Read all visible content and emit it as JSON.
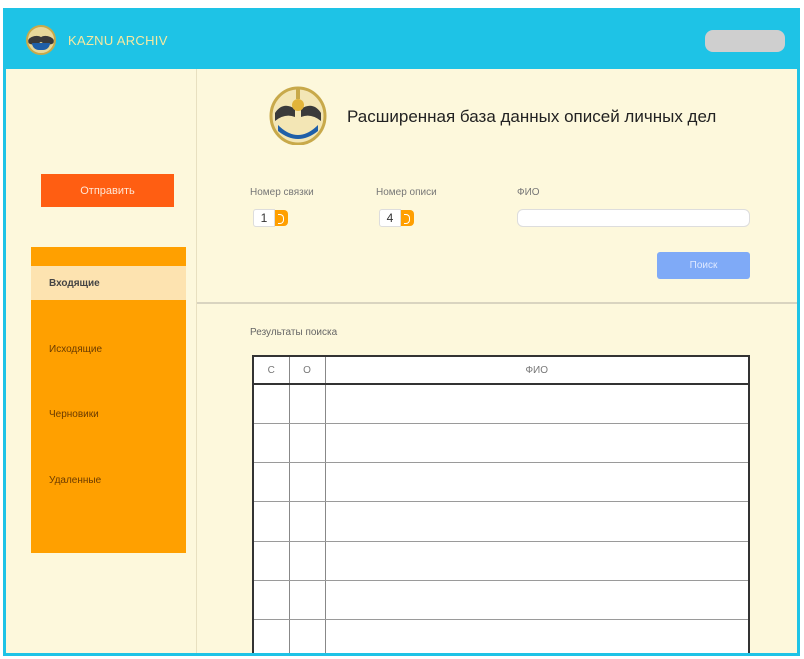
{
  "header": {
    "app_title": "KAZNU ARCHIV",
    "logo_icon": "kaznu-emblem-icon",
    "accent_color": "#1ec3e6"
  },
  "sidebar": {
    "send_label": "Отправить",
    "items": [
      {
        "label": "Входящие",
        "active": true
      },
      {
        "label": "Исходящие",
        "active": false
      },
      {
        "label": "Черновики",
        "active": false
      },
      {
        "label": "Удаленные",
        "active": false
      }
    ]
  },
  "search": {
    "db_title": "Расширенная база данных описей личных дел",
    "bundle_label": "Номер связки",
    "bundle_value": "1",
    "inventory_label": "Номер описи",
    "inventory_value": "4",
    "fio_label": "ФИО",
    "fio_value": "",
    "search_label": "Поиск"
  },
  "results": {
    "label": "Результаты поиска",
    "columns": [
      "С",
      "О",
      "ФИО"
    ],
    "rows": [
      [
        "",
        "",
        ""
      ],
      [
        "",
        "",
        ""
      ],
      [
        "",
        "",
        ""
      ],
      [
        "",
        "",
        ""
      ],
      [
        "",
        "",
        ""
      ],
      [
        "",
        "",
        ""
      ],
      [
        "",
        "",
        ""
      ]
    ]
  }
}
